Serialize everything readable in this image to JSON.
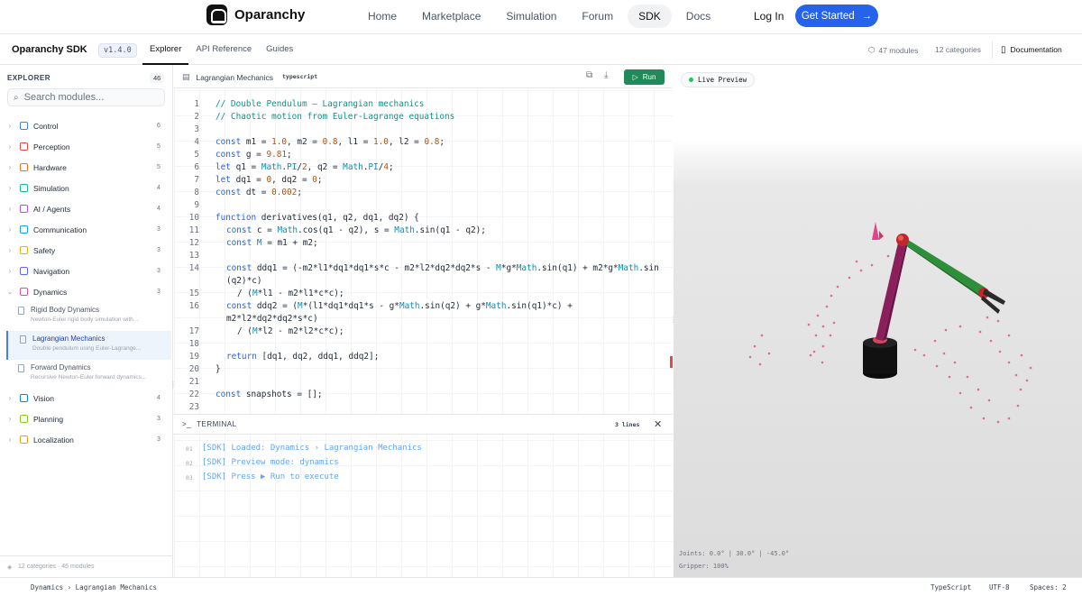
{
  "nav": {
    "logo_text": "Oparanchy",
    "links": [
      "Home",
      "Marketplace",
      "Simulation",
      "Forum",
      "SDK",
      "Docs"
    ],
    "active_link": "SDK",
    "login": "Log In",
    "get_started": "Get Started"
  },
  "sdk": {
    "title": "Oparanchy SDK",
    "version": "v1.4.0",
    "tabs": [
      "Explorer",
      "API Reference",
      "Guides"
    ],
    "modules_stat": "47 modules",
    "categories_stat": "12 categories",
    "documentation": "Documentation"
  },
  "sidebar": {
    "title": "EXPLORER",
    "count": "46",
    "search_placeholder": "Search modules...",
    "categories": [
      {
        "label": "Control",
        "count": "6",
        "color": "#3b82f6"
      },
      {
        "label": "Perception",
        "count": "5",
        "color": "#ef4444"
      },
      {
        "label": "Hardware",
        "count": "5",
        "color": "#f97316"
      },
      {
        "label": "Simulation",
        "count": "4",
        "color": "#14b8a6"
      },
      {
        "label": "AI / Agents",
        "count": "4",
        "color": "#a855f7"
      },
      {
        "label": "Communication",
        "count": "3",
        "color": "#0ea5e9"
      },
      {
        "label": "Safety",
        "count": "3",
        "color": "#eab308"
      },
      {
        "label": "Navigation",
        "count": "3",
        "color": "#6366f1"
      },
      {
        "label": "Dynamics",
        "count": "3",
        "color": "#ec4899"
      },
      {
        "label": "Vision",
        "count": "4",
        "color": "#0891b2"
      },
      {
        "label": "Planning",
        "count": "3",
        "color": "#84cc16"
      },
      {
        "label": "Localization",
        "count": "3",
        "color": "#f59e0b"
      }
    ],
    "dynamics_items": [
      {
        "name": "Rigid Body Dynamics",
        "desc": "Newton-Euler rigid body simulation with..."
      },
      {
        "name": "Lagrangian Mechanics",
        "desc": "Double pendulum using Euler-Lagrange..."
      },
      {
        "name": "Forward Dynamics",
        "desc": "Recursive Newton-Euler forward dynamics..."
      }
    ],
    "footer": "12 categories · 46 modules"
  },
  "editor": {
    "file": "Lagrangian Mechanics",
    "lang": "typescript",
    "run": "Run",
    "line_numbers": [
      "1",
      "2",
      "3",
      "4",
      "5",
      "6",
      "7",
      "8",
      "9",
      "10",
      "11",
      "12",
      "13",
      "14",
      "",
      "15",
      "16",
      "",
      "17",
      "18",
      "19",
      "20",
      "21",
      "22",
      "23"
    ]
  },
  "terminal": {
    "title": "TERMINAL",
    "lines_count": "3 lines",
    "lines": [
      {
        "n": "01",
        "text": "[SDK] Loaded: Dynamics › Lagrangian Mechanics"
      },
      {
        "n": "02",
        "text": "[SDK] Preview mode: dynamics"
      },
      {
        "n": "03",
        "text": "[SDK] Press ▶ Run to execute"
      }
    ]
  },
  "preview": {
    "live": "Live Preview",
    "joints": "Joints: 0.0° | 30.0° | -45.0°",
    "gripper": "Gripper: 100%"
  },
  "status": {
    "crumb": "Dynamics  ›  Lagrangian Mechanics",
    "lang": "TypeScript",
    "encoding": "UTF-8",
    "spaces": "Spaces: 2"
  }
}
